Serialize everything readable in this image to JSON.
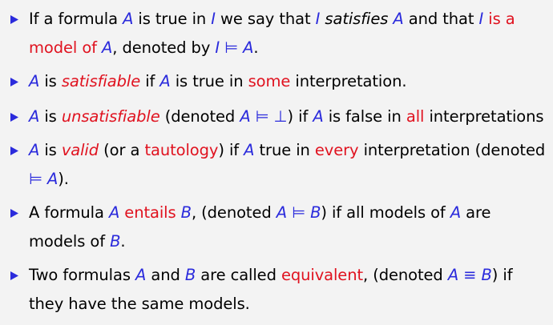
{
  "colors": {
    "math": "#2b2bdc",
    "highlight": "#e0121f",
    "bullet": "#2b2bdc",
    "background": "#f3f3f3"
  },
  "items": [
    {
      "t1": "If a formula ",
      "a": "A",
      "t2": " is true in ",
      "i": "I",
      "t3": " we say that ",
      "i2": "I",
      "t4": " ",
      "satisfies": "satisfies",
      "t5": " ",
      "a2": "A",
      "t6": " and that ",
      "i3": "I",
      "t7": " ",
      "model": "is a model of",
      "t8": " ",
      "a3": "A",
      "t9": ", denoted by ",
      "i4": "I",
      "models_sym": " ⊨ ",
      "a4": "A",
      "t10": "."
    },
    {
      "a": "A",
      "t1": " is ",
      "satisfiable": "satisfiable",
      "t2": " if ",
      "a2": "A",
      "t3": " is true in ",
      "some": "some",
      "t4": " interpretation."
    },
    {
      "a": "A",
      "t1": " is ",
      "unsatisfiable": "unsatisfiable",
      "t2": " (denoted ",
      "a2": "A",
      "models_sym": " ⊨ ⊥",
      "t3": ") if ",
      "a3": "A",
      "t4": " is false in ",
      "all": "all",
      "t5": " interpretations"
    },
    {
      "a": "A",
      "t1": " is ",
      "valid": "valid",
      "t2": " (or a ",
      "tautology": "tautology",
      "t3": ") if ",
      "a2": "A",
      "t4": " true in ",
      "every": "every",
      "t5": " interpretation (denoted ",
      "models_sym": "⊨ ",
      "a3": "A",
      "t6": ")."
    },
    {
      "t1": "A formula ",
      "a": "A",
      "t2": " ",
      "entails": "entails",
      "t3": " ",
      "b": "B",
      "t4": ", (denoted ",
      "a2": "A",
      "models_sym": " ⊨ ",
      "b2": "B",
      "t5": ") if all models of ",
      "a3": "A",
      "t6": " are models of ",
      "b3": "B",
      "t7": "."
    },
    {
      "t1": "Two formulas ",
      "a": "A",
      "t2": " and ",
      "b": "B",
      "t3": " are called ",
      "equivalent": "equivalent",
      "t4": ", (denoted ",
      "a2": "A",
      "equiv_sym": " ≡ ",
      "b2": "B",
      "t5": ") if they have the same models."
    }
  ]
}
